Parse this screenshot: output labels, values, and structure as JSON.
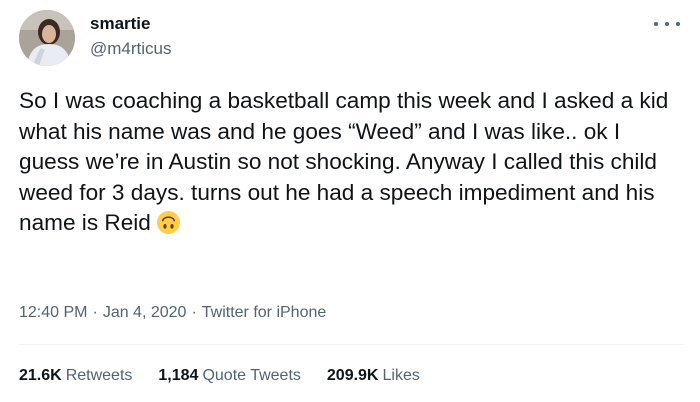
{
  "author": {
    "display_name": "smartie",
    "handle": "@m4rticus"
  },
  "tweet": {
    "text": "So I was coaching a basketball camp this week and I asked a kid what his name was and he goes “Weed” and I was like.. ok I guess we’re in Austin so not shocking. Anyway I called this child weed for 3 days. turns out he had a speech impediment and his name is Reid",
    "emoji": "upside-down-face-emoji"
  },
  "meta": {
    "time": "12:40 PM",
    "separator": "·",
    "date": "Jan 4, 2020",
    "source": "Twitter for iPhone"
  },
  "stats": {
    "retweets_count": "21.6K",
    "retweets_label": "Retweets",
    "quotes_count": "1,184",
    "quotes_label": "Quote Tweets",
    "likes_count": "209.9K",
    "likes_label": "Likes"
  },
  "icons": {
    "more": "more-horizontal-icon"
  },
  "colors": {
    "text_primary": "#0f1419",
    "text_secondary": "#536471",
    "divider": "#eff3f4",
    "emoji_face": "#ffcc4d"
  }
}
